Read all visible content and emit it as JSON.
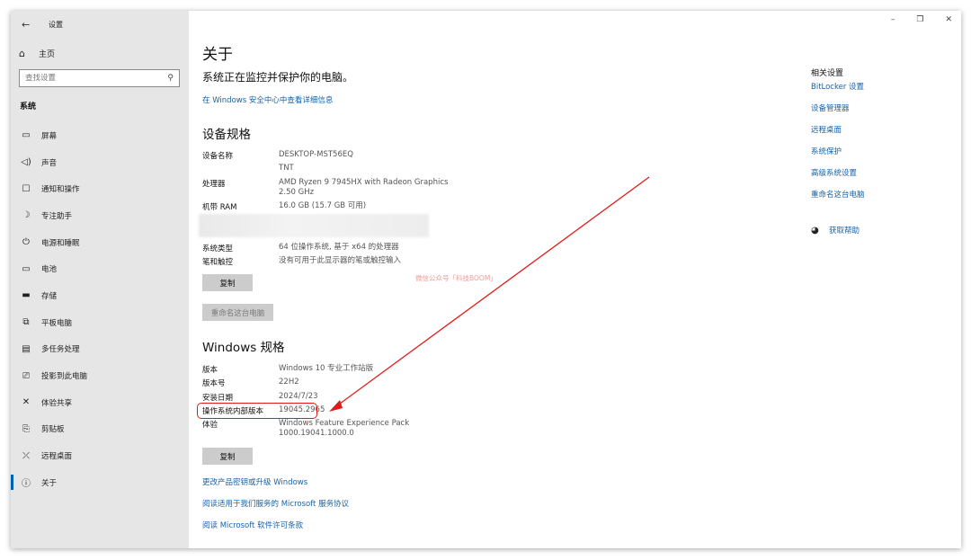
{
  "window": {
    "title": "设置",
    "minimize": "–",
    "maximize": "❐",
    "close": "✕"
  },
  "sidebar": {
    "home_label": "主页",
    "search_placeholder": "查找设置",
    "section": "系统",
    "items": [
      {
        "label": "屏幕",
        "icon": "monitor-icon"
      },
      {
        "label": "声音",
        "icon": "speaker-icon"
      },
      {
        "label": "通知和操作",
        "icon": "notification-icon"
      },
      {
        "label": "专注助手",
        "icon": "moon-icon"
      },
      {
        "label": "电源和睡眠",
        "icon": "power-icon"
      },
      {
        "label": "电池",
        "icon": "battery-icon"
      },
      {
        "label": "存储",
        "icon": "storage-icon"
      },
      {
        "label": "平板电脑",
        "icon": "tablet-icon"
      },
      {
        "label": "多任务处理",
        "icon": "multitask-icon"
      },
      {
        "label": "投影到此电脑",
        "icon": "project-icon"
      },
      {
        "label": "体验共享",
        "icon": "share-icon"
      },
      {
        "label": "剪贴板",
        "icon": "clipboard-icon"
      },
      {
        "label": "远程桌面",
        "icon": "remote-desktop-icon"
      },
      {
        "label": "关于",
        "icon": "info-icon"
      }
    ],
    "active_index": 13
  },
  "main": {
    "title": "关于",
    "protect_text": "系统正在监控并保护你的电脑。",
    "security_link": "在 Windows 安全中心中查看详细信息",
    "device_specs_title": "设备规格",
    "device_specs": [
      {
        "label": "设备名称",
        "value": "DESKTOP-MST56EQ"
      },
      {
        "label": "",
        "value": "TNT"
      },
      {
        "label": "处理器",
        "value": "AMD Ryzen 9 7945HX with Radeon Graphics"
      },
      {
        "label": "",
        "value": "2.50 GHz"
      },
      {
        "label": "机带 RAM",
        "value": "16.0 GB (15.7 GB 可用)"
      },
      {
        "label": "系统类型",
        "value": "64 位操作系统, 基于 x64 的处理器"
      },
      {
        "label": "笔和触控",
        "value": "没有可用于此显示器的笔或触控输入"
      }
    ],
    "copy_button": "复制",
    "rename_button": "重命名这台电脑",
    "watermark": "微信公众号「科技BOOM」",
    "windows_specs_title": "Windows 规格",
    "windows_specs": [
      {
        "label": "版本",
        "value": "Windows 10 专业工作站版"
      },
      {
        "label": "版本号",
        "value": "22H2"
      },
      {
        "label": "安装日期",
        "value": "2024/7/23"
      },
      {
        "label": "操作系统内部版本",
        "value": "19045.2965"
      },
      {
        "label": "体验",
        "value": "Windows Feature Experience Pack"
      },
      {
        "label": "",
        "value": "1000.19041.1000.0"
      }
    ],
    "copy_button2": "复制",
    "footer_links": [
      "更改产品密钥或升级 Windows",
      "阅读适用于我们服务的 Microsoft 服务协议",
      "阅读 Microsoft 软件许可条款"
    ]
  },
  "related": {
    "title": "相关设置",
    "links": [
      "BitLocker 设置",
      "设备管理器",
      "远程桌面",
      "系统保护",
      "高级系统设置",
      "重命名这台电脑"
    ],
    "help": "获取帮助"
  },
  "colors": {
    "accent": "#0063b1",
    "link": "#1862a8",
    "annotation": "#e11b1b"
  }
}
